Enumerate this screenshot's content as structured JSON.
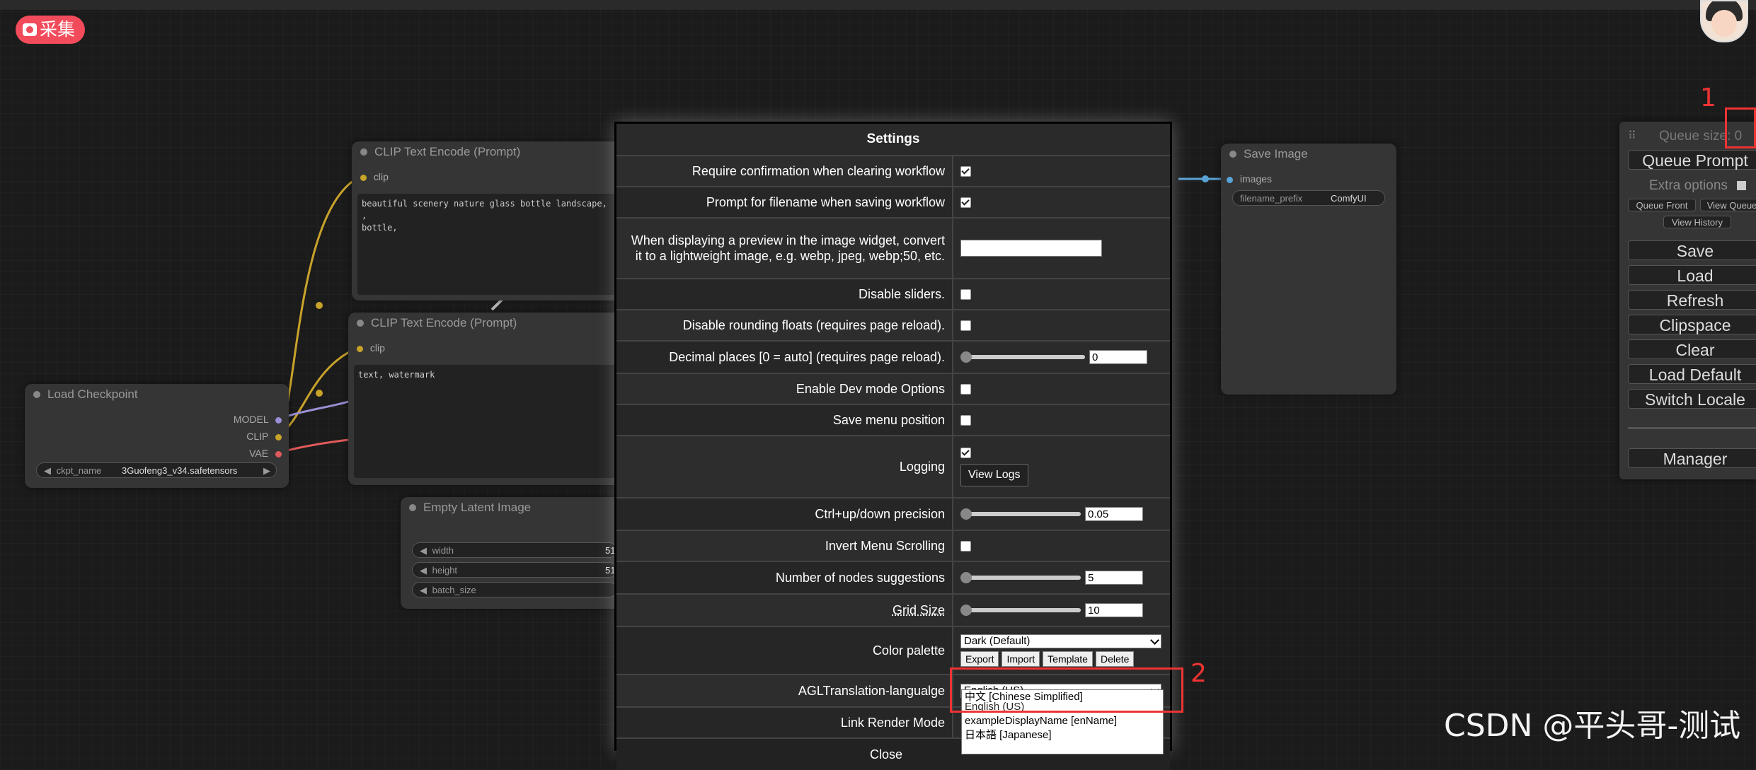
{
  "collect_badge": "采集",
  "nodes": {
    "clip_text_encode_1": {
      "title": "CLIP Text Encode (Prompt)",
      "input": "clip",
      "text": "beautiful scenery nature glass bottle landscape, , \nbottle,"
    },
    "clip_text_encode_2": {
      "title": "CLIP Text Encode (Prompt)",
      "input": "clip",
      "text": "text, watermark"
    },
    "load_checkpoint": {
      "title": "Load Checkpoint",
      "outputs": [
        "MODEL",
        "CLIP",
        "VAE"
      ],
      "ckpt_label": "ckpt_name",
      "ckpt_value": "3Guofeng3_v34.safetensors"
    },
    "empty_latent": {
      "title": "Empty Latent Image",
      "widgets": [
        "width",
        "height",
        "batch_size"
      ],
      "width_value": "51",
      "height_value": "51"
    },
    "save_image": {
      "title": "Save Image",
      "input": "images",
      "prefix_label": "filename_prefix",
      "prefix_value": "ComfyUI"
    }
  },
  "settings": {
    "title": "Settings",
    "rows": {
      "require_confirm": "Require confirmation when clearing workflow",
      "prompt_filename": "Prompt for filename when saving workflow",
      "preview_format": "When displaying a preview in the image widget, convert it to a lightweight image, e.g. webp, jpeg, webp;50, etc.",
      "disable_sliders": "Disable sliders.",
      "disable_rounding": "Disable rounding floats (requires page reload).",
      "decimal_places": "Decimal places [0 = auto] (requires page reload).",
      "dev_mode": "Enable Dev mode Options",
      "save_menu_pos": "Save menu position",
      "logging": "Logging",
      "ctrl_precision": "Ctrl+up/down precision",
      "invert_scrolling": "Invert Menu Scrolling",
      "node_suggestions": "Number of nodes suggestions",
      "grid_size": "Grid Size",
      "color_palette": "Color palette",
      "agl_language": "AGLTranslation-langualge",
      "link_render": "Link Render Mode"
    },
    "values": {
      "decimal_places": "0",
      "ctrl_precision": "0.05",
      "node_suggestions": "5",
      "grid_size": "10",
      "color_palette": "Dark (Default)",
      "agl_language": "English (US)"
    },
    "checked": {
      "require_confirm": true,
      "prompt_filename": true,
      "disable_sliders": false,
      "disable_rounding": false,
      "dev_mode": false,
      "save_menu_pos": false,
      "logging": true,
      "invert_scrolling": false
    },
    "view_logs": "View Logs",
    "palette_buttons": [
      "Export",
      "Import",
      "Template",
      "Delete"
    ],
    "close": "Close",
    "language_options": [
      "中文 [Chinese Simplified]",
      "English (US)",
      "exampleDisplayName [enName]",
      "日本語 [Japanese]"
    ]
  },
  "queue": {
    "size_label": "Queue size: 0",
    "queue_prompt": "Queue Prompt",
    "extra_options": "Extra options",
    "queue_front": "Queue Front",
    "view_queue": "View Queue",
    "view_history": "View History",
    "buttons": [
      "Save",
      "Load",
      "Refresh",
      "Clipspace",
      "Clear",
      "Load Default",
      "Switch Locale"
    ],
    "manager": "Manager"
  },
  "annotations": {
    "one": "1",
    "two": "2"
  },
  "watermark": "CSDN @平头哥-测试",
  "colors": {
    "annotation_red": "#e33333",
    "clip_link": "#c8a32a",
    "model_link": "#9a8fd6",
    "vae_link": "#e05a5a",
    "badge_red": "#f24b5b"
  }
}
